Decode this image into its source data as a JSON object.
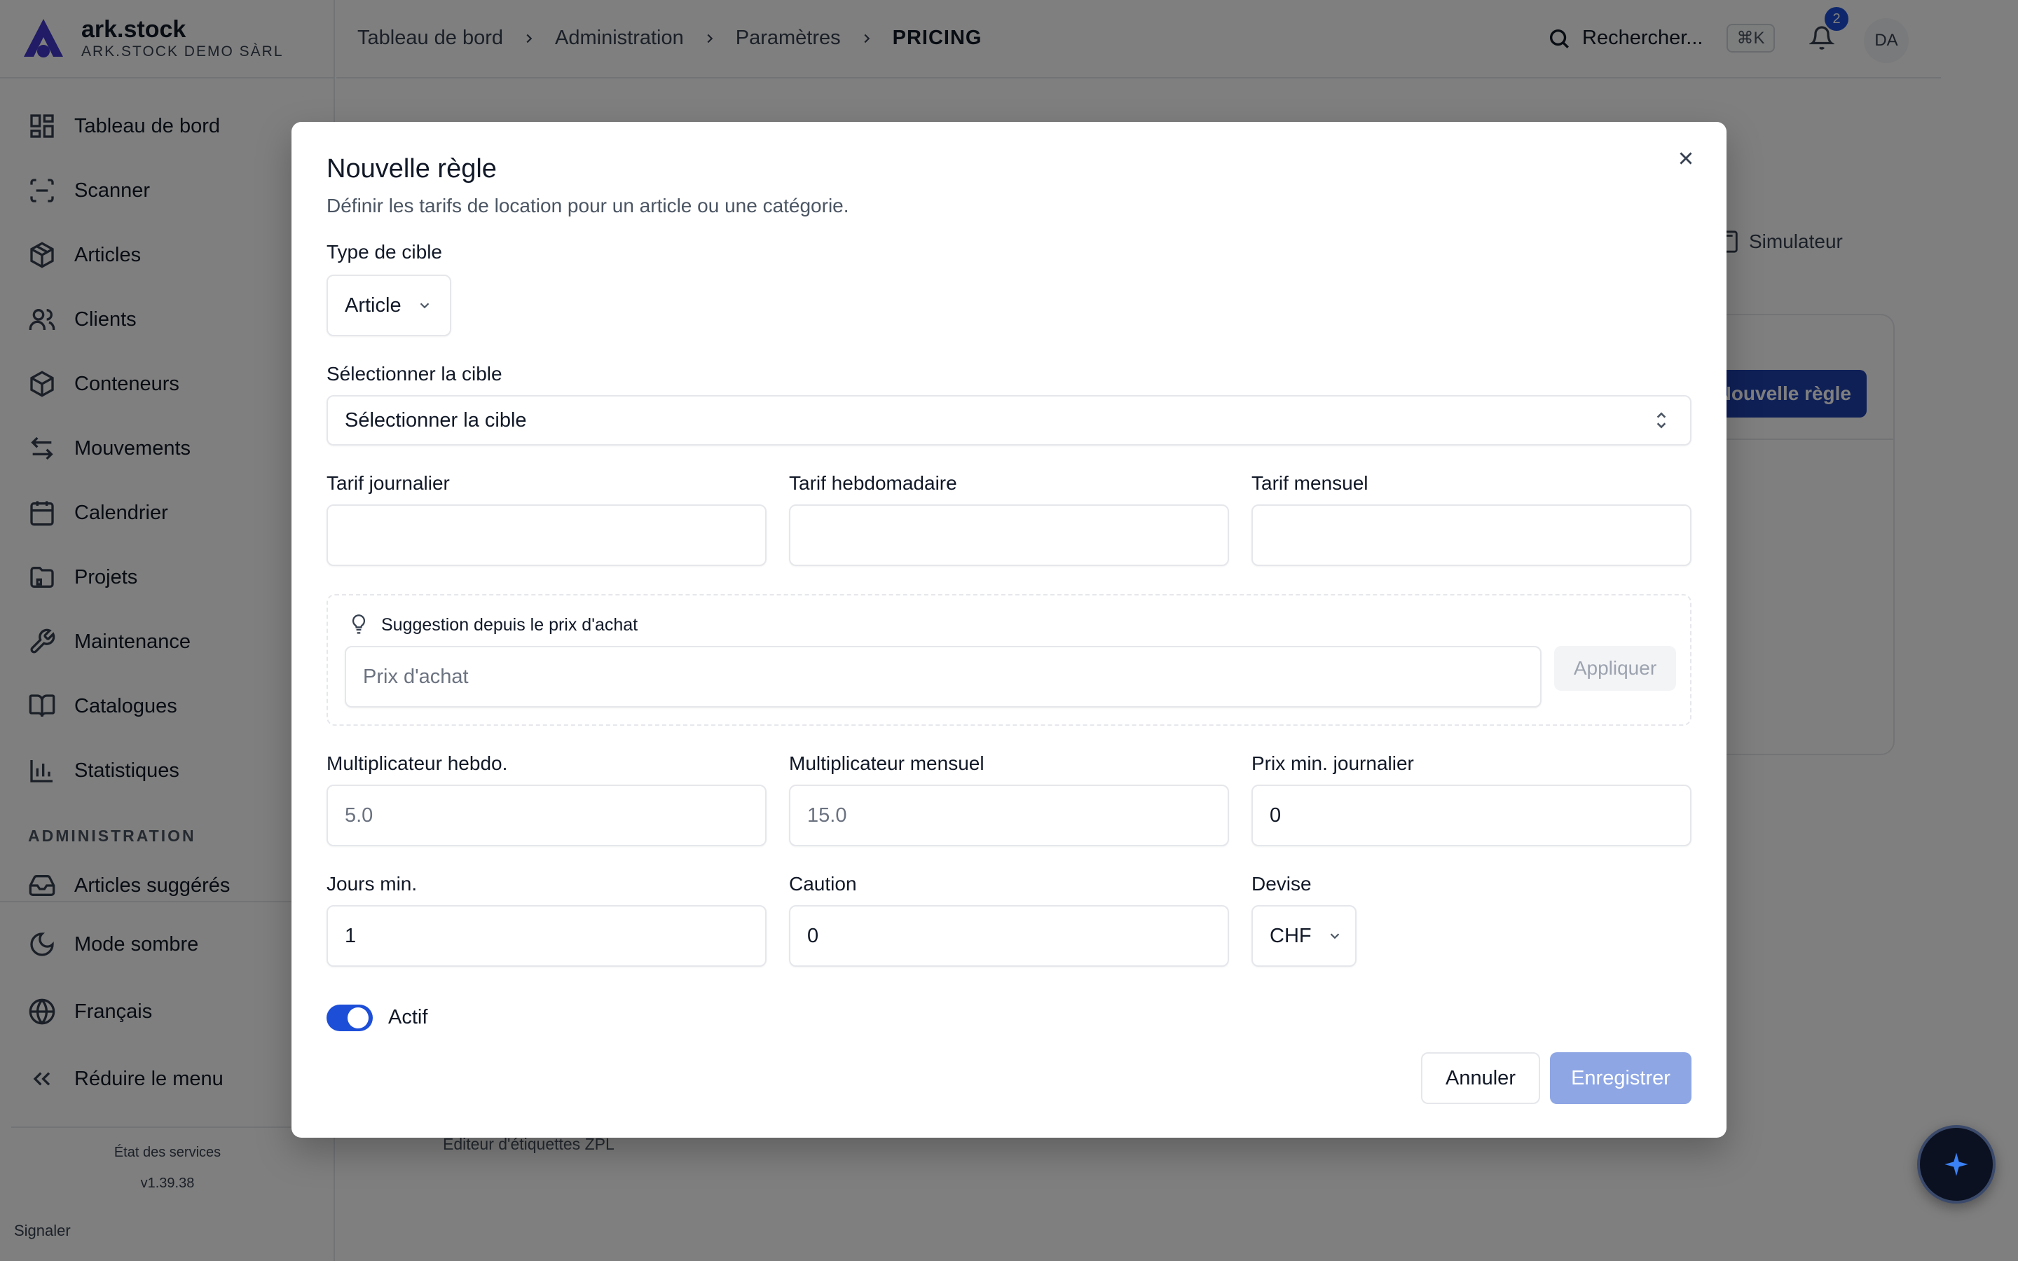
{
  "brand": {
    "name": "ark.stock",
    "org": "ARK.STOCK DEMO SÀRL"
  },
  "sidebar": {
    "items": [
      {
        "label": "Tableau de bord",
        "icon": "dashboard-icon"
      },
      {
        "label": "Scanner",
        "icon": "scan-icon"
      },
      {
        "label": "Articles",
        "icon": "box-icon"
      },
      {
        "label": "Clients",
        "icon": "users-icon"
      },
      {
        "label": "Conteneurs",
        "icon": "container-icon"
      },
      {
        "label": "Mouvements",
        "icon": "arrows-icon"
      },
      {
        "label": "Calendrier",
        "icon": "calendar-icon"
      },
      {
        "label": "Projets",
        "icon": "folder-icon"
      },
      {
        "label": "Maintenance",
        "icon": "wrench-icon"
      },
      {
        "label": "Catalogues",
        "icon": "book-icon"
      },
      {
        "label": "Statistiques",
        "icon": "chart-icon"
      }
    ],
    "section_admin": "ADMINISTRATION",
    "admin_items": [
      {
        "label": "Articles suggérés",
        "icon": "inbox-icon"
      }
    ],
    "bottom": {
      "dark_mode": "Mode sombre",
      "language": "Français",
      "collapse": "Réduire le menu"
    },
    "status": "État des services",
    "version": "v1.39.38",
    "report": "Signaler"
  },
  "topbar": {
    "breadcrumbs": [
      "Tableau de bord",
      "Administration",
      "Paramètres"
    ],
    "current": "PRICING",
    "search_label": "Rechercher...",
    "search_shortcut": "⌘K",
    "notif_count": "2",
    "avatar": "DA"
  },
  "background": {
    "simulateur": "Simulateur",
    "new_rule": "Nouvelle règle",
    "zpl_editor": "Éditeur d'étiquettes ZPL"
  },
  "modal": {
    "title": "Nouvelle règle",
    "description": "Définir les tarifs de location pour un article ou une catégorie.",
    "target_type_label": "Type de cible",
    "target_type_value": "Article",
    "target_label": "Sélectionner la cible",
    "target_value": "Sélectionner la cible",
    "daily_label": "Tarif journalier",
    "weekly_label": "Tarif hebdomadaire",
    "monthly_label": "Tarif mensuel",
    "daily_value": "",
    "weekly_value": "",
    "monthly_value": "",
    "suggest_title": "Suggestion depuis le prix d'achat",
    "purchase_placeholder": "Prix d'achat",
    "apply": "Appliquer",
    "weekly_mult_label": "Multiplicateur hebdo.",
    "weekly_mult_placeholder": "5.0",
    "monthly_mult_label": "Multiplicateur mensuel",
    "monthly_mult_placeholder": "15.0",
    "min_daily_label": "Prix min. journalier",
    "min_daily_value": "0",
    "min_days_label": "Jours min.",
    "min_days_value": "1",
    "deposit_label": "Caution",
    "deposit_value": "0",
    "currency_label": "Devise",
    "currency_value": "CHF",
    "active_label": "Actif",
    "active": true,
    "cancel": "Annuler",
    "save": "Enregistrer"
  },
  "colors": {
    "primary": "#1d4ed8",
    "save_disabled": "#8ea6e4",
    "overlay": "rgba(0,0,0,0.5)"
  }
}
